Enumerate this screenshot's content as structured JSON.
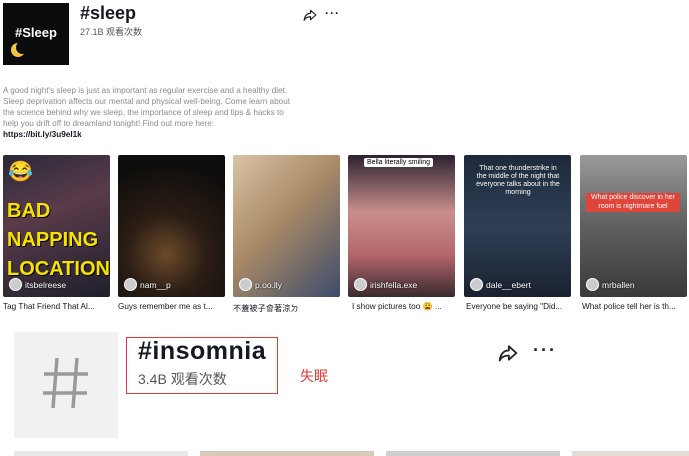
{
  "tag1": {
    "cover_text": "#Sleep",
    "title": "#sleep",
    "views": "27.1B 观看次数",
    "description": "A good night's sleep is just as important as regular exercise and a healthy diet. Sleep deprivation affects our mental and physical well-being. Come learn about the science behind why we sleep, the importance of sleep and tips & hacks to help you drift off to dreamland tonight! Find out more here:",
    "link": "https://bit.ly/3u9el1k",
    "icons": {
      "share": "share-icon",
      "more": "more-icon"
    }
  },
  "videos": [
    {
      "author": "itsbelreese",
      "caption": "Tag That Friend That Al...",
      "overlay": "BAD NAPPING LOCATION",
      "emoji": "😂"
    },
    {
      "author": "nam__p",
      "caption": "Guys remember me as t..."
    },
    {
      "author": "p.oo.lly",
      "caption": "不蓋被子會著涼ㄉ"
    },
    {
      "author": "irishfella.exe",
      "caption": "I show pictures too 😩 ...",
      "overlay": "Bella literally smiling"
    },
    {
      "author": "dale__ebert",
      "caption": "Everyone be saying \"Did...",
      "overlay": "That one thunderstrike in the middle of the night that everyone talks about in the morning"
    },
    {
      "author": "mrballen",
      "caption": "What police tell her is th...",
      "overlay": "What police discover in her room is nightmare fuel"
    }
  ],
  "tag2": {
    "title": "#insomnia",
    "views": "3.4B 观看次数",
    "annotation": "失眠",
    "icons": {
      "cover": "hashtag-icon",
      "share": "share-icon",
      "more": "more-icon"
    }
  },
  "more_symbol": "···",
  "colors": {
    "annotation_red": "#e53935",
    "text_dark": "#161823",
    "text_gray": "#8a8b91"
  }
}
